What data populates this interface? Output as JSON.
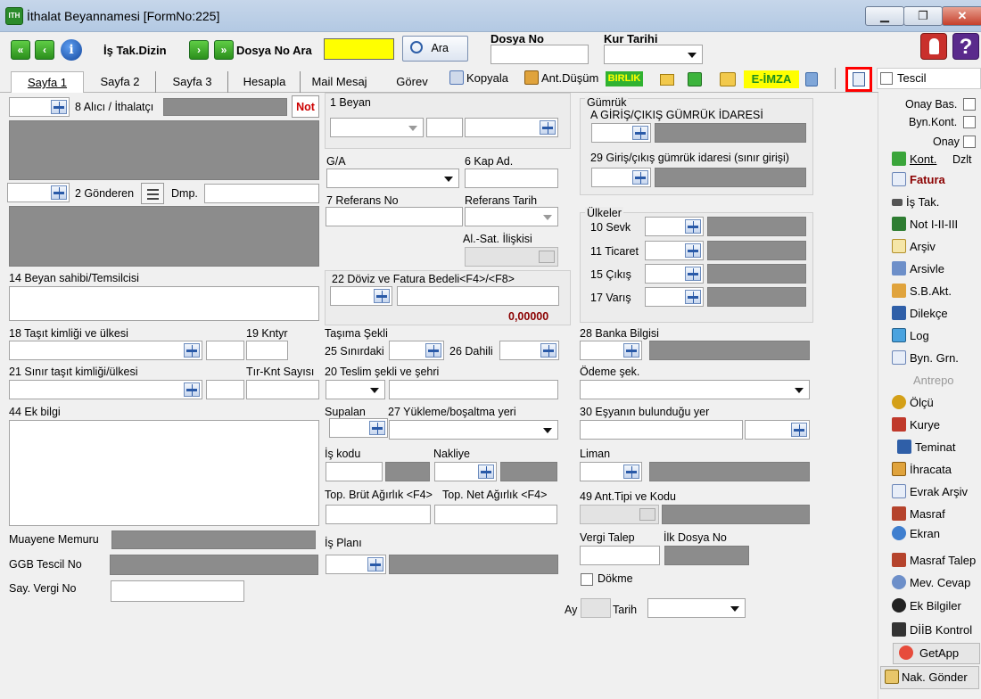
{
  "window": {
    "title": "İthalat Beyannamesi [FormNo:225]",
    "app_logo": "ITH",
    "min_label": "▁",
    "max_label": "❐",
    "close_label": "✕"
  },
  "toolbar": {
    "first_label": "«",
    "prev_label": "‹",
    "info_label": "i",
    "is_takip_label": "İş Tak.Dizin",
    "next_label": "›",
    "last_label": "»",
    "dosya_no_ara_label": "Dosya No Ara",
    "search_value": "",
    "ara_button": "Ara",
    "dosya_no_label": "Dosya No",
    "dosya_no_value": "",
    "kur_tarihi_label": "Kur Tarihi",
    "kur_tarihi_value": "",
    "help_label": "?"
  },
  "tabs": [
    "Sayfa 1",
    "Sayfa 2",
    "Sayfa 3",
    "Hesapla",
    "Mail Mesaj",
    "Görev"
  ],
  "tools": {
    "kopyala": "Kopyala",
    "ant_dusum": "Ant.Düşüm",
    "birlik": "BIRLIK",
    "eimza": "E-İMZA",
    "tescil": "Tescil"
  },
  "left": {
    "alici": "8 Alıcı / İthalatçı",
    "not_btn": "Not",
    "gonderen": "2 Gönderen",
    "dmp": "Dmp.",
    "beyan_sahibi": "14 Beyan sahibi/Temsilcisi",
    "tasit": "18 Taşıt kimliği ve ülkesi",
    "kntyr": "19 Kntyr",
    "sinir_tasit": "21 Sınır taşıt kimliği/ülkesi",
    "tir_knt": "Tır-Knt Sayısı",
    "ek_bilgi": "44 Ek bilgi",
    "muayene": "Muayene Memuru",
    "ggb": "GGB Tescil No",
    "say_vergi": "Say. Vergi No"
  },
  "middle": {
    "beyan": "1 Beyan",
    "ga": "G/A",
    "kap_ad": "6 Kap Ad.",
    "referans_no": "7 Referans No",
    "referans_tarih": "Referans Tarih",
    "al_sat": "Al.-Sat. İlişkisi",
    "doviz": "22 Döviz ve Fatura Bedeli<F4>/<F8>",
    "doviz_amount": "0,00000",
    "tasima_sekli": "Taşıma Şekli",
    "sinirdaki": "25 Sınırdaki",
    "dahili": "26 Dahili",
    "teslim": "20 Teslim şekli ve şehri",
    "supalan": "Supalan",
    "yukleme": "27 Yükleme/boşaltma yeri",
    "is_kodu": "İş kodu",
    "nakliye": "Nakliye",
    "brut": "Top. Brüt Ağırlık <F4>",
    "net": "Top. Net Ağırlık <F4>",
    "is_plani": "İş Planı"
  },
  "right": {
    "gumruk": "Gümrük",
    "giris_cikis": "A GİRİŞ/ÇIKIŞ GÜMRÜK İDARESİ",
    "sinir_girisi": "29 Giriş/çıkış gümrük idaresi (sınır girişi)",
    "ulkeler": "Ülkeler",
    "sevk": "10 Sevk",
    "ticaret": "11 Ticaret",
    "cikis": "15 Çıkış",
    "varis": "17 Varış",
    "banka": "28 Banka Bilgisi",
    "odeme": "Ödeme şek.",
    "esya_yer": "30 Eşyanın bulunduğu yer",
    "liman": "Liman",
    "ant_tipi": "49 Ant.Tipi ve Kodu",
    "vergi_talep": "Vergi Talep",
    "ilk_dosya": "İlk Dosya No",
    "dokme": "Dökme",
    "ay": "Ay",
    "tarih": "Tarih"
  },
  "sidebar": {
    "onay_bas": "Onay Bas.",
    "byn_kont": "Byn.Kont.",
    "onay": "Onay",
    "kont": "Kont.",
    "dzlt": "Dzlt",
    "fatura": "Fatura",
    "is_tak": "İş Tak.",
    "not_hiii": "Not I-II-III",
    "arsiv": "Arşiv",
    "arsivle": "Arsivle",
    "sb_akt": "S.B.Akt.",
    "dilekce": "Dilekçe",
    "log": "Log",
    "byn_grn": "Byn. Grn.",
    "antrepo": "Antrepo",
    "olcu": "Ölçü",
    "kurye": "Kurye",
    "teminat": "Teminat",
    "ihracata": "İhracata",
    "evrak_arsiv": "Evrak Arşiv",
    "masraf": "Masraf",
    "ekran": "Ekran",
    "masraf_talep": "Masraf Talep",
    "mev_cevap": "Mev. Cevap",
    "ek_bilgiler": "Ek Bilgiler",
    "diib": "DİİB Kontrol",
    "getapp": "GetApp",
    "nak_gonder": "Nak. Gönder"
  },
  "colors": {
    "highlight_yellow": "#ffff00",
    "note_red": "#cc0000",
    "amount_red": "#8b0000"
  }
}
